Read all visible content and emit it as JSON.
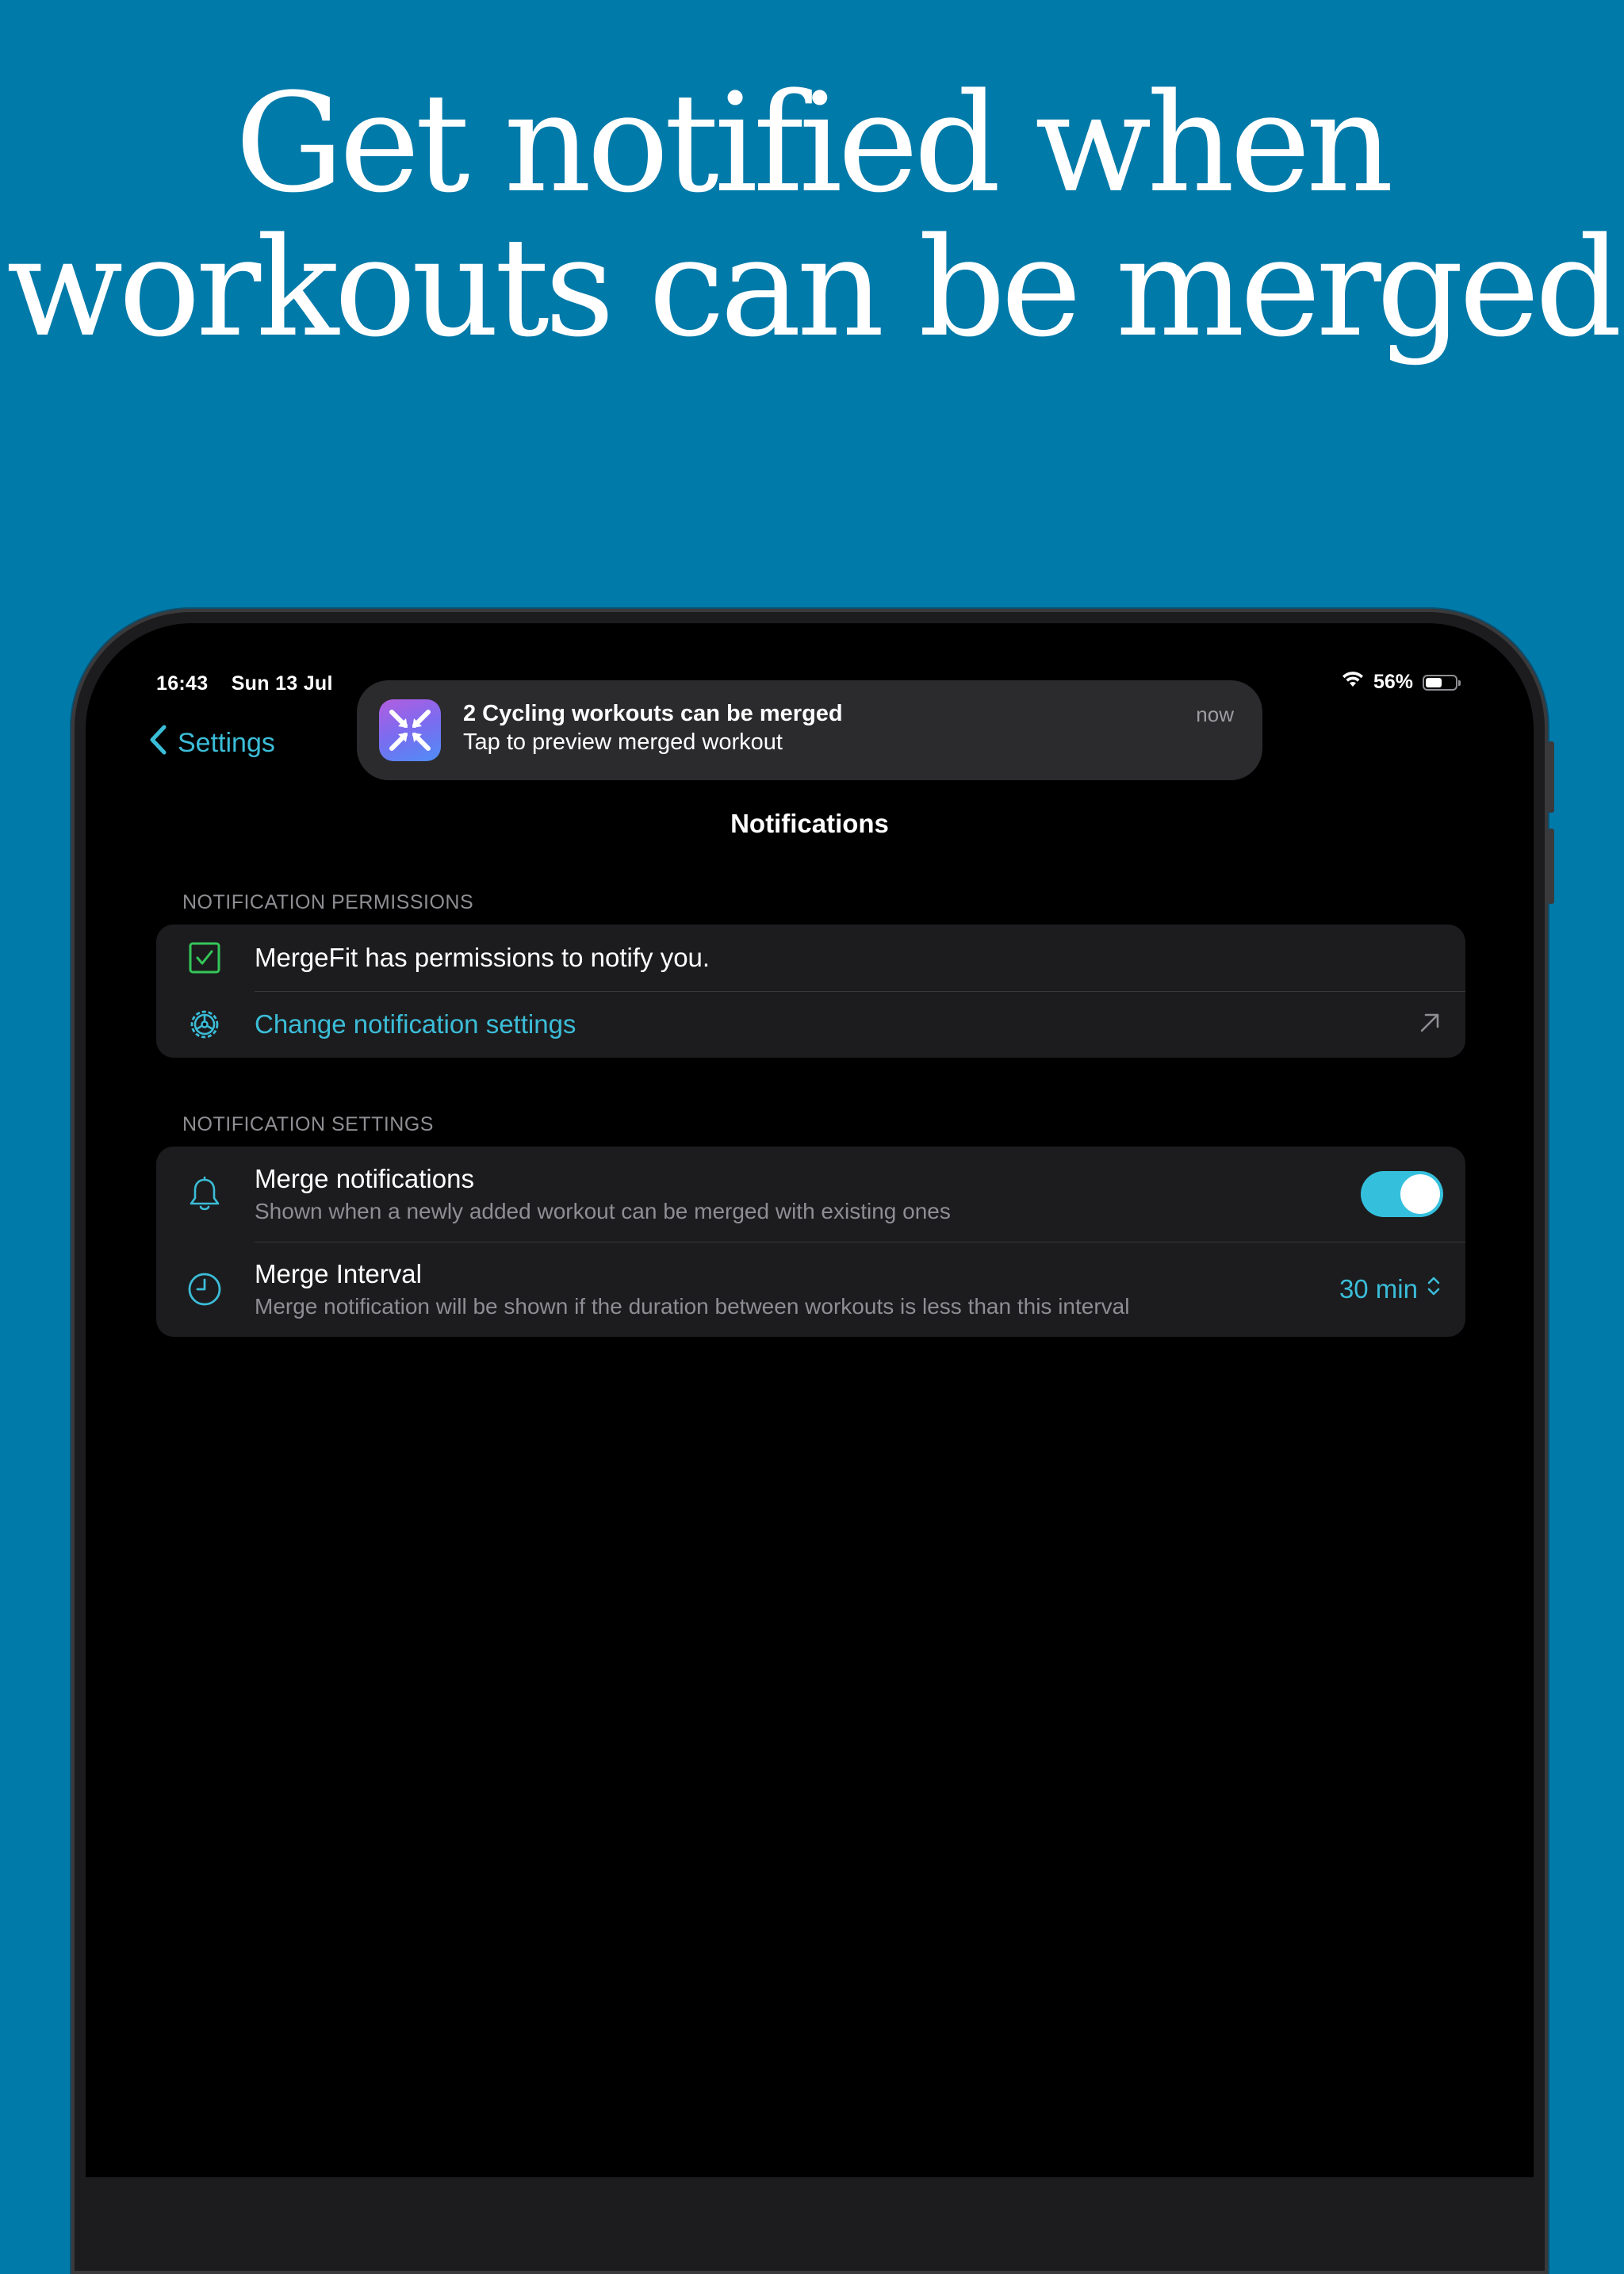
{
  "headline": {
    "line1": "Get notified when",
    "line2": "workouts can be merged"
  },
  "status_bar": {
    "time": "16:43",
    "date": "Sun 13 Jul",
    "battery_percent": "56%",
    "battery_level": 0.56
  },
  "nav": {
    "back_label": "Settings",
    "title": "Notifications"
  },
  "notification_banner": {
    "title": "2 Cycling workouts can be merged",
    "body": "Tap to preview merged workout",
    "time": "now"
  },
  "permissions_section": {
    "header": "NOTIFICATION PERMISSIONS",
    "status_text": "MergeFit has permissions to notify you.",
    "change_link": "Change notification settings"
  },
  "settings_section": {
    "header": "NOTIFICATION SETTINGS",
    "merge_notifications": {
      "title": "Merge notifications",
      "subtitle": "Shown when a newly added workout can be merged with existing ones",
      "enabled": true
    },
    "merge_interval": {
      "title": "Merge Interval",
      "subtitle": "Merge notification will be shown if the duration between workouts is less than this interval",
      "value": "30 min"
    }
  },
  "colors": {
    "background": "#007aa9",
    "accent": "#3bbdd8",
    "check_green": "#34c759"
  }
}
